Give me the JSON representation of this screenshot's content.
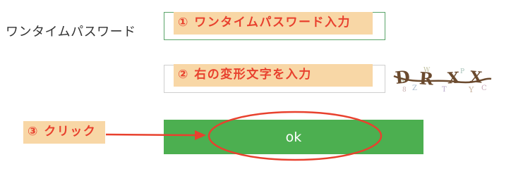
{
  "form": {
    "otp_label": "ワンタイムパスワード",
    "otp_value": "",
    "captcha_value": "",
    "ok_label": "ok",
    "captcha_image_text": "DRXX"
  },
  "annotations": {
    "step1": "① ワンタイムパスワード入力",
    "step2": "② 右の変形文字を入力",
    "step3": "③ クリック"
  },
  "colors": {
    "callout_bg": "#f8d7a6",
    "callout_text": "#e8412e",
    "button_bg": "#4caf50",
    "annotation_red": "#e8412e",
    "otp_border": "#5aa469"
  },
  "icons": {
    "arrow": "right-arrow-icon",
    "ellipse": "highlight-ellipse"
  }
}
